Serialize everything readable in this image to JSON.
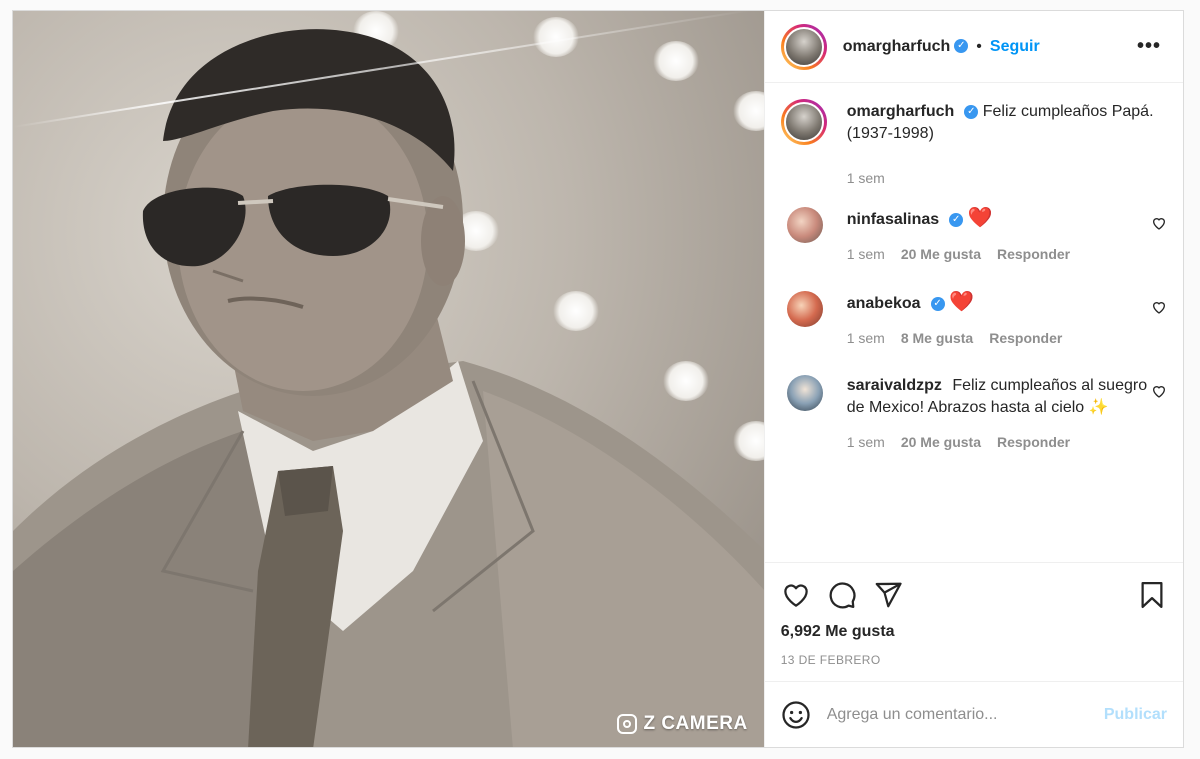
{
  "post": {
    "author": "omargharfuch",
    "follow_label": "Seguir",
    "separator": "•",
    "more_label": "•••",
    "watermark": "Z CAMERA",
    "caption": "Feliz cumpleaños Papá. (1937-1998)",
    "caption_time": "1 sem",
    "likes_total": "6,992 Me gusta",
    "date": "13 DE FEBRERO"
  },
  "comments": [
    {
      "user": "ninfasalinas",
      "verified": true,
      "text": "❤️",
      "time": "1 sem",
      "likes": "20 Me gusta",
      "reply": "Responder"
    },
    {
      "user": "anabekoa",
      "verified": true,
      "text": "❤️",
      "time": "1 sem",
      "likes": "8 Me gusta",
      "reply": "Responder"
    },
    {
      "user": "saraivaldzpz",
      "verified": false,
      "text": "Feliz cumpleaños al suegro de Mexico! Abrazos hasta al cielo ✨",
      "time": "1 sem",
      "likes": "20 Me gusta",
      "reply": "Responder"
    }
  ],
  "composer": {
    "placeholder": "Agrega un comentario...",
    "publish_label": "Publicar"
  },
  "colors": {
    "link": "#0095f6",
    "verified": "#3897f0",
    "heart": "#ed4956"
  }
}
